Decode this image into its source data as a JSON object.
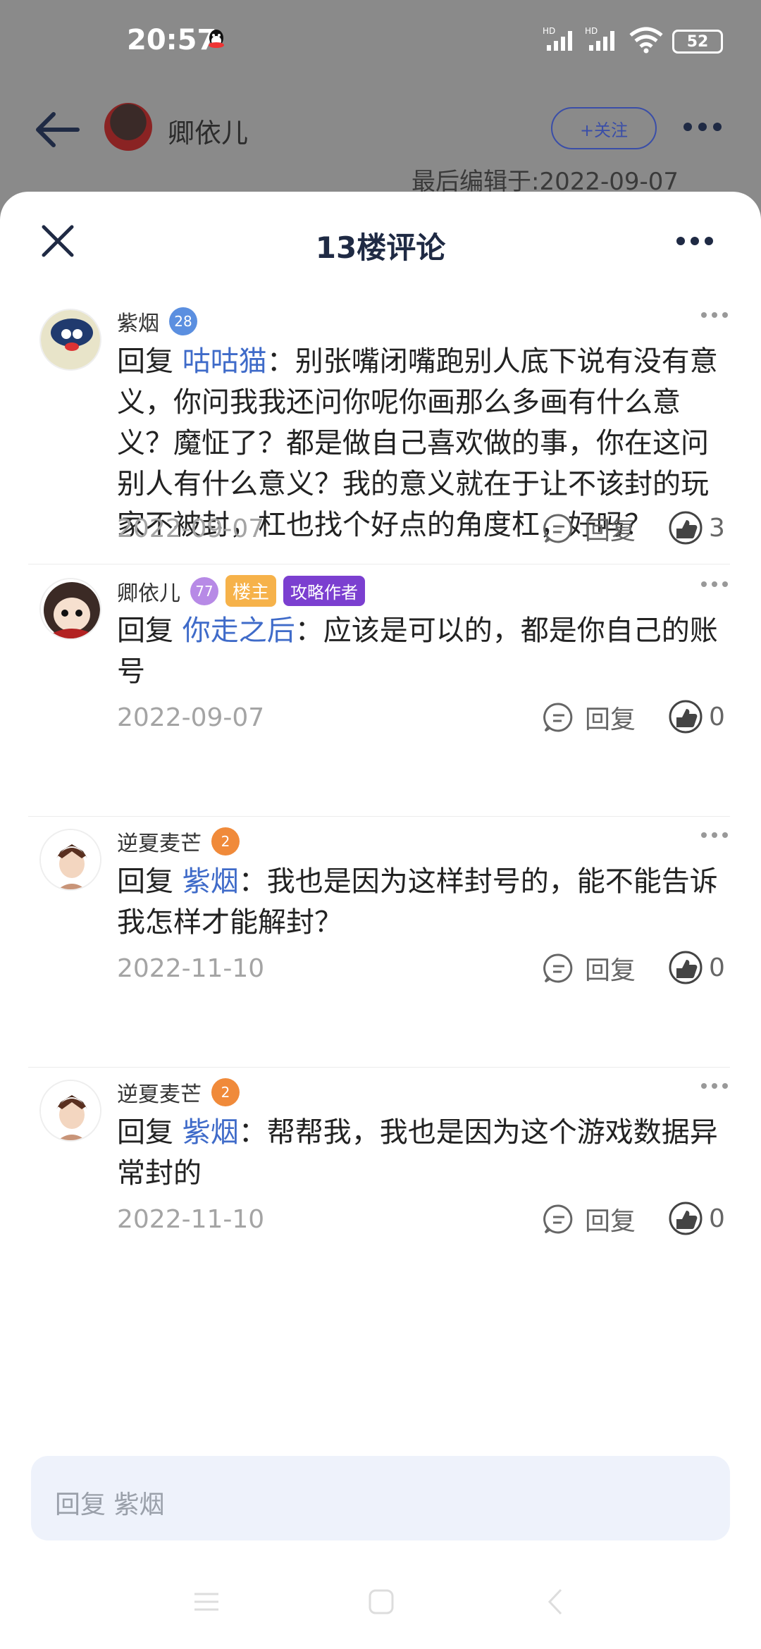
{
  "status_bar": {
    "time": "20:57",
    "signal1": "HD",
    "signal2": "HD",
    "battery": "52"
  },
  "background_header": {
    "username": "卿依儿",
    "follow_label": "+关注",
    "edit_text": "最后编辑于:2022-09-07"
  },
  "sheet": {
    "title": "13楼评论"
  },
  "comments": [
    {
      "username": "紫烟",
      "level": "28",
      "reply_prefix": "回复",
      "reply_to": "咕咕猫",
      "text": "：别张嘴闭嘴跑别人底下说有没有意义，你问我我还问你呢你画那么多画有什么意义？魔怔了？都是做自己喜欢做的事，你在这问别人有什么意义？我的意义就在于让不该封的玩家不被封，杠也找个好点的角度杠，好吗？",
      "date": "2022-09-07",
      "reply_label": "回复",
      "likes": "3"
    },
    {
      "username": "卿依儿",
      "level": "77",
      "badge_owner": "楼主",
      "badge_author": "攻略作者",
      "reply_prefix": "回复",
      "reply_to": "你走之后",
      "text": "：应该是可以的，都是你自己的账号",
      "date": "2022-09-07",
      "reply_label": "回复",
      "likes": "0"
    },
    {
      "username": "逆夏麦芒",
      "level": "2",
      "reply_prefix": "回复",
      "reply_to": "紫烟",
      "text": "：我也是因为这样封号的，能不能告诉我怎样才能解封？",
      "date": "2022-11-10",
      "reply_label": "回复",
      "likes": "0"
    },
    {
      "username": "逆夏麦芒",
      "level": "2",
      "reply_prefix": "回复",
      "reply_to": "紫烟",
      "text": "：帮帮我，我也是因为这个游戏数据异常封的",
      "date": "2022-11-10",
      "reply_label": "回复",
      "likes": "0"
    }
  ],
  "input": {
    "placeholder": "回复 紫烟"
  },
  "colors": {
    "accent": "#3f6bc9",
    "title": "#1f2a44",
    "owner_badge": "#f6b24a",
    "author_badge": "#7b3fd0"
  }
}
